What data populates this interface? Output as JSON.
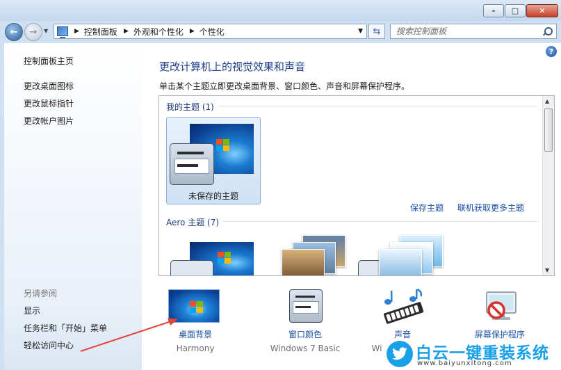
{
  "address": {
    "crumbs": [
      "控制面板",
      "外观和个性化",
      "个性化"
    ]
  },
  "search": {
    "placeholder": "搜索控制面板"
  },
  "sidebar": {
    "top_links": [
      "控制面板主页",
      "更改桌面图标",
      "更改鼠标指针",
      "更改帐户图片"
    ],
    "see_also_heading": "另请参阅",
    "see_also_links": [
      "显示",
      "任务栏和「开始」菜单",
      "轻松访问中心"
    ]
  },
  "main": {
    "help_label": "?",
    "title": "更改计算机上的视觉效果和声音",
    "description": "单击某个主题立即更改桌面背景、窗口颜色、声音和屏幕保护程序。",
    "my_themes_heading": "我的主题 (1)",
    "unsaved_theme_label": "未保存的主题",
    "save_theme_link": "保存主题",
    "get_more_link": "联机获取更多主题",
    "aero_heading": "Aero 主题 (7)"
  },
  "bottom": [
    {
      "label": "桌面背景",
      "sub": "Harmony",
      "icon": "desktop-background-icon"
    },
    {
      "label": "窗口颜色",
      "sub": "Windows 7 Basic",
      "icon": "window-color-icon"
    },
    {
      "label": "声音",
      "sub": "Wi",
      "icon": "sound-icon"
    },
    {
      "label": "屏幕保护程序",
      "sub": "",
      "icon": "screen-saver-icon"
    }
  ],
  "watermark": {
    "title": "白云一键重装系统",
    "url": "www.baiyunxitong.com"
  },
  "colors": {
    "link": "#1a4fa8",
    "title": "#1d3f8a",
    "annotation_arrow": "#e0453c",
    "watermark": "#18a0ea"
  }
}
